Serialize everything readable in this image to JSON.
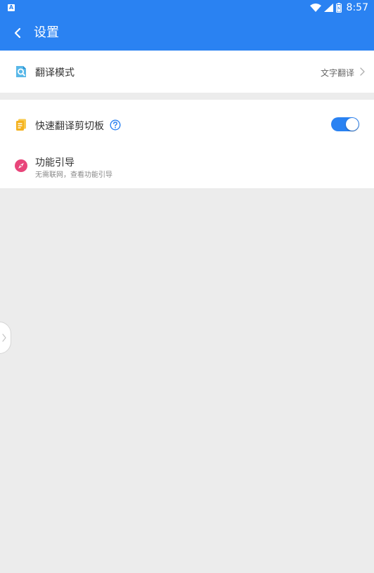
{
  "statusbar": {
    "left_icon": "A",
    "time": "8:57",
    "icons": [
      "wifi-icon",
      "signal-icon",
      "battery-icon"
    ]
  },
  "header": {
    "title": "设置",
    "back_icon": "chevron-left-icon"
  },
  "settings": {
    "translation_mode": {
      "label": "翻译模式",
      "value": "文字翻译",
      "icon": "translate-search-icon"
    },
    "quick_clipboard": {
      "label": "快速翻译剪切板",
      "help_icon": "help-icon",
      "enabled": true,
      "icon": "clipboard-icon"
    },
    "guide": {
      "label": "功能引导",
      "sublabel": "无需联网，查看功能引导",
      "icon": "compass-icon"
    }
  },
  "colors": {
    "primary": "#2a82f2",
    "background": "#ececec",
    "clipboard_icon": "#f5b21f",
    "compass_icon": "#e8457a"
  }
}
